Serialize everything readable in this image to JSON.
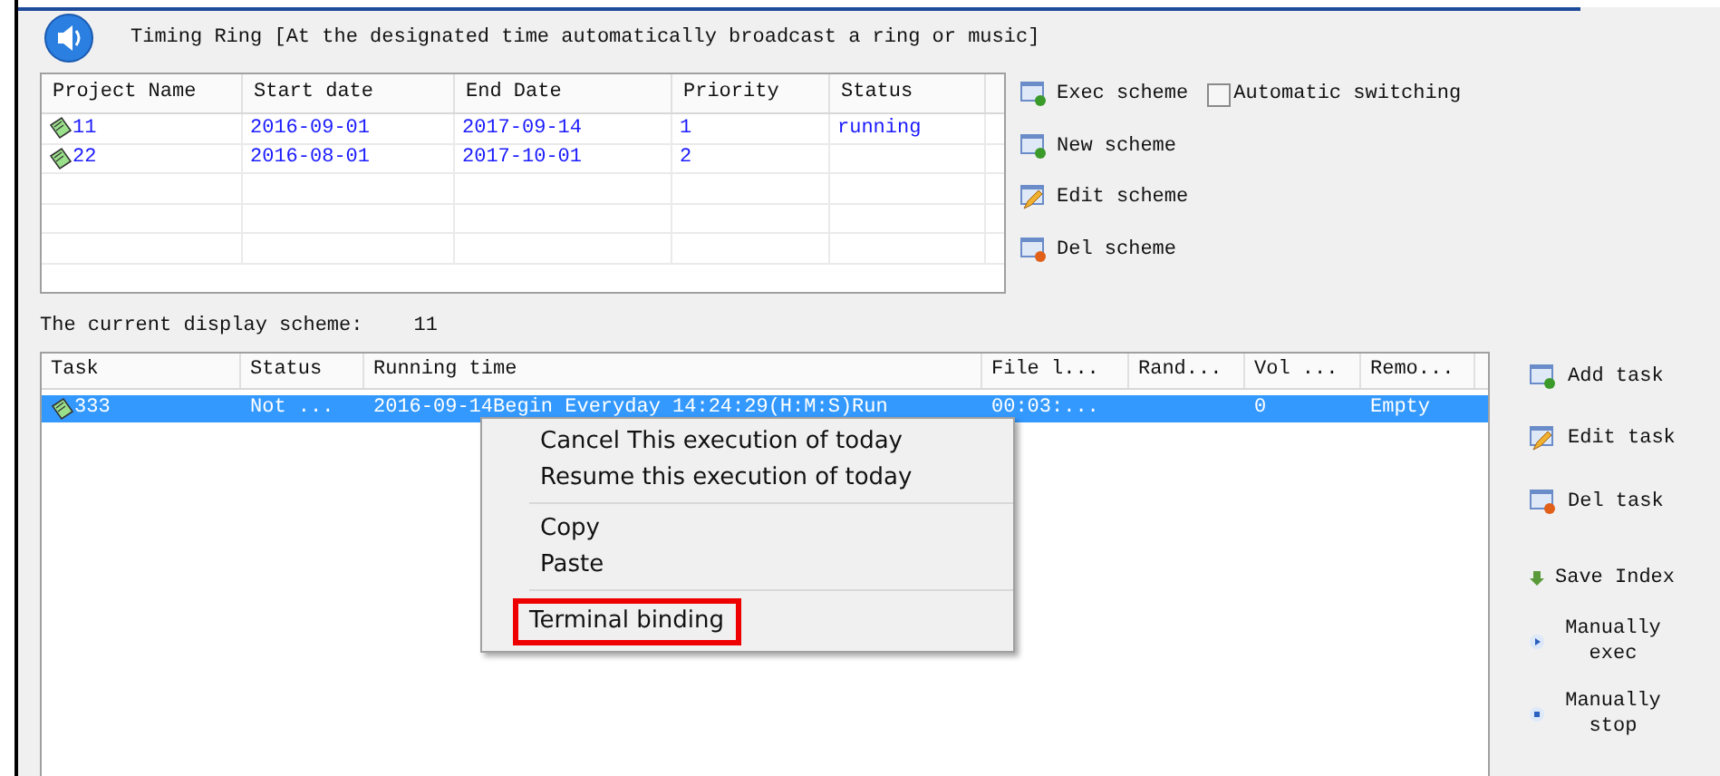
{
  "window": {
    "title": "Timing Ring [At the designated time automatically broadcast a ring or music]"
  },
  "schemes_table": {
    "columns": [
      "Project Name",
      "Start date",
      "End Date",
      "Priority",
      "Status"
    ],
    "rows": [
      {
        "cells": [
          "11",
          "2016-09-01",
          "2017-09-14",
          "1",
          "running"
        ]
      },
      {
        "cells": [
          "22",
          "2016-08-01",
          "2017-10-01",
          "2",
          ""
        ]
      }
    ]
  },
  "scheme_buttons": [
    {
      "label": "Exec scheme",
      "kind": "exec"
    },
    {
      "label": "New scheme",
      "kind": "new"
    },
    {
      "label": "Edit scheme",
      "kind": "edit"
    },
    {
      "label": "Del scheme",
      "kind": "del"
    }
  ],
  "auto_switch": {
    "label": "Automatic switching",
    "checked": false
  },
  "current_scheme": {
    "label": "The current display scheme:",
    "value": "11"
  },
  "tasks_table": {
    "columns": [
      "Task",
      "Status",
      "Running time",
      "File l...",
      "Rand...",
      "Vol ...",
      "Remo..."
    ],
    "rows": [
      {
        "selected": true,
        "cells": [
          "333",
          "Not ...",
          "2016-09-14Begin  Everyday  14:24:29(H:M:S)Run",
          "00:03:...",
          "",
          "0",
          "Empty"
        ]
      }
    ]
  },
  "task_buttons": [
    {
      "label": "Add task",
      "kind": "add"
    },
    {
      "label": "Edit task",
      "kind": "edit"
    },
    {
      "label": "Del task",
      "kind": "del"
    },
    {
      "label": "Save Index",
      "kind": "save"
    },
    {
      "label": "Manually exec",
      "kind": "exec"
    },
    {
      "label": "Manually stop",
      "kind": "stop"
    }
  ],
  "context_menu": {
    "groups": [
      [
        {
          "label": "Cancel This execution of today",
          "highlighted": false
        },
        {
          "label": "Resume this execution of today",
          "highlighted": false
        }
      ],
      [
        {
          "label": "Copy",
          "highlighted": false
        },
        {
          "label": "Paste",
          "highlighted": false
        }
      ],
      [
        {
          "label": "Terminal binding",
          "highlighted": true
        }
      ]
    ]
  }
}
